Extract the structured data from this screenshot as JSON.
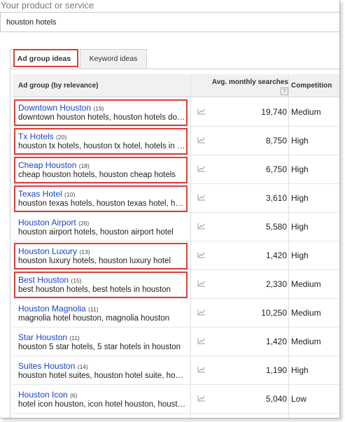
{
  "product_label": "Your product or service",
  "search_value": "houston hotels",
  "tabs": [
    {
      "label": "Ad group ideas",
      "active": true
    },
    {
      "label": "Keyword ideas",
      "active": false
    }
  ],
  "table": {
    "headers": {
      "ad_group": "Ad group (by relevance)",
      "avg_monthly": "Avg. monthly searches",
      "help": "?",
      "competition": "Competition"
    },
    "rows": [
      {
        "name": "Downtown Houston",
        "count": "(19)",
        "keywords": "downtown houston hotels, houston hotels downtown",
        "searches": "19,740",
        "competition": "Medium",
        "highlighted": true
      },
      {
        "name": "Tx Hotels",
        "count": "(20)",
        "keywords": "houston tx hotels, houston tx hotel, hotels in houston tx",
        "searches": "8,750",
        "competition": "High",
        "highlighted": true
      },
      {
        "name": "Cheap Houston",
        "count": "(18)",
        "keywords": "cheap houston hotels, houston cheap hotels",
        "searches": "6,750",
        "competition": "High",
        "highlighted": true
      },
      {
        "name": "Texas Hotel",
        "count": "(10)",
        "keywords": "houston texas hotels, houston texas hotel, hotels",
        "searches": "3,610",
        "competition": "High",
        "highlighted": true
      },
      {
        "name": "Houston Airport",
        "count": "(26)",
        "keywords": "houston airport hotels, houston airport hotel",
        "searches": "5,580",
        "competition": "High",
        "highlighted": false
      },
      {
        "name": "Houston Luxury",
        "count": "(13)",
        "keywords": "houston luxury hotels, houston luxury hotel",
        "searches": "1,420",
        "competition": "High",
        "highlighted": true
      },
      {
        "name": "Best Houston",
        "count": "(15)",
        "keywords": "best houston hotels, best hotels in houston",
        "searches": "2,330",
        "competition": "Medium",
        "highlighted": true
      },
      {
        "name": "Houston Magnolia",
        "count": "(11)",
        "keywords": "magnolia hotel houston, magnolia houston",
        "searches": "10,250",
        "competition": "Medium",
        "highlighted": false
      },
      {
        "name": "Star Houston",
        "count": "(11)",
        "keywords": "houston 5 star hotels, 5 star hotels in houston",
        "searches": "1,420",
        "competition": "Medium",
        "highlighted": false
      },
      {
        "name": "Suites Houston",
        "count": "(14)",
        "keywords": "houston hotel suites, houston hotel suite, houston",
        "searches": "1,190",
        "competition": "High",
        "highlighted": false
      },
      {
        "name": "Houston Icon",
        "count": "(6)",
        "keywords": "hotel icon houston, icon hotel houston, houston",
        "searches": "5,040",
        "competition": "Low",
        "highlighted": false
      }
    ]
  },
  "colors": {
    "link": "#1a44c8",
    "highlight": "#d9403a",
    "header_bg": "#f1f1f1",
    "trend_icon": "#9a9a9a"
  },
  "icons": {
    "trend": "line-chart-icon"
  }
}
